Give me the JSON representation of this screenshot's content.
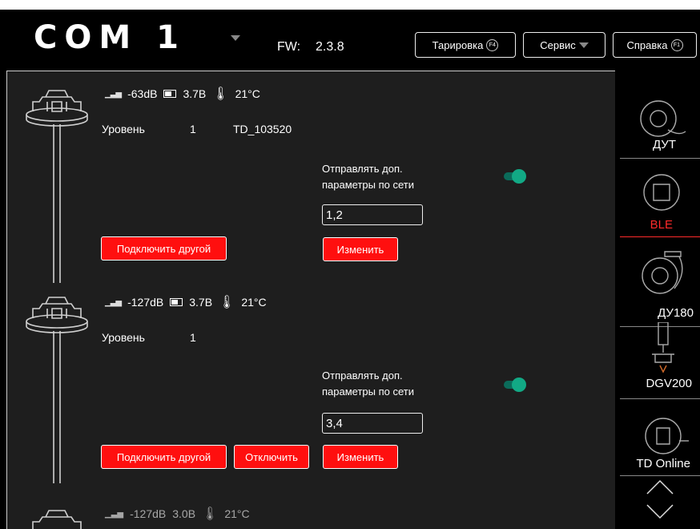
{
  "header": {
    "port": "COM 1",
    "fw_label": "FW:",
    "fw_value": "2.3.8",
    "buttons": {
      "calibration": "Тарировка",
      "calibration_key": "F4",
      "service": "Сервис",
      "help": "Справка",
      "help_key": "F1"
    }
  },
  "sensors": [
    {
      "signal": "-63dB",
      "battery": "3.7B",
      "temperature": "21°C",
      "level_label": "Уровень",
      "level_value": "1",
      "device_id": "TD_103520",
      "send_label_line1": "Отправлять доп.",
      "send_label_line2": "параметры по сети",
      "params_value": "1,2",
      "change_button": "Изменить",
      "connect_other_button": "Подключить другой"
    },
    {
      "signal": "-127dB",
      "battery": "3.7B",
      "temperature": "21°C",
      "level_label": "Уровень",
      "level_value": "1",
      "send_label_line1": "Отправлять доп.",
      "send_label_line2": "параметры по сети",
      "params_value": "3,4",
      "change_button": "Изменить",
      "connect_other_button": "Подключить другой",
      "disconnect_button": "Отключить"
    },
    {
      "signal": "-127dB",
      "battery": "3.0B",
      "temperature": "21°C"
    }
  ],
  "sidebar": {
    "items": [
      {
        "label": "ДУТ",
        "active": false
      },
      {
        "label": "BLE",
        "active": true
      },
      {
        "label": "ДУ180",
        "active": false
      },
      {
        "label": "DGV200",
        "active": false
      },
      {
        "label": "TD Online",
        "active": false
      }
    ]
  },
  "colors": {
    "accent_red": "#ff0f0f",
    "toggle_on": "#12a985",
    "active_label": "#ff2a2a"
  }
}
